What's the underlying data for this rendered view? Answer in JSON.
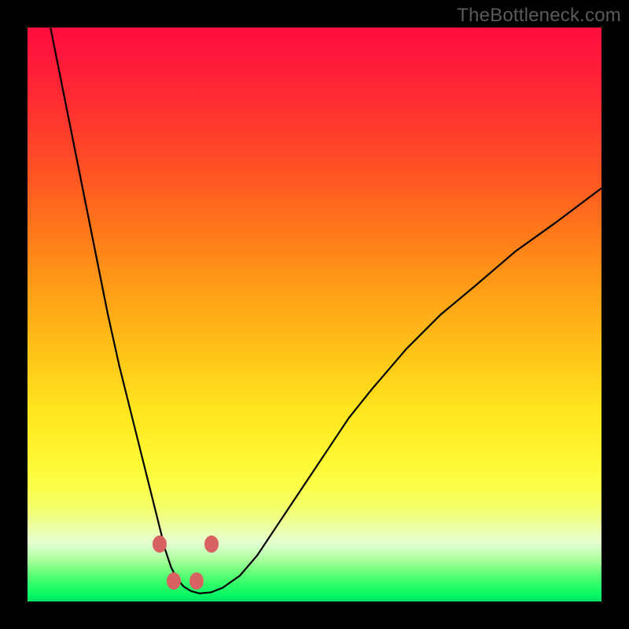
{
  "watermark": "TheBottleneck.com",
  "colors": {
    "page_bg": "#000000",
    "curve": "#000000",
    "marker": "#d86262",
    "watermark": "#5a5a5a"
  },
  "chart_data": {
    "type": "line",
    "title": "",
    "xlabel": "",
    "ylabel": "",
    "xlim": [
      0,
      100
    ],
    "ylim": [
      0,
      100
    ],
    "grid": false,
    "legend": false,
    "series": [
      {
        "name": "bottleneck-curve",
        "x": [
          4,
          6,
          8,
          10,
          12,
          14,
          16,
          18,
          20,
          21.5,
          23,
          24,
          25,
          26,
          27.2,
          28.5,
          30,
          32,
          34,
          37,
          40,
          44,
          48,
          52,
          56,
          60,
          66,
          72,
          78,
          85,
          92,
          100
        ],
        "y": [
          100,
          90,
          80,
          70,
          60,
          50,
          41,
          33,
          25,
          19,
          13,
          9,
          6,
          4,
          2.6,
          1.8,
          1.4,
          1.6,
          2.4,
          4.5,
          8,
          14,
          20,
          26,
          32,
          37,
          44,
          50,
          55,
          61,
          66,
          72
        ]
      }
    ],
    "markers": [
      {
        "name": "left-upper",
        "x": 23.0,
        "y": 10.0
      },
      {
        "name": "left-lower",
        "x": 25.5,
        "y": 3.5
      },
      {
        "name": "right-lower",
        "x": 29.5,
        "y": 3.5
      },
      {
        "name": "right-upper",
        "x": 32.0,
        "y": 10.0
      }
    ],
    "gradient": {
      "top": "#ff0d3e",
      "mid_upper": "#ff9a18",
      "mid": "#fff52e",
      "mid_lower": "#ecffa3",
      "bottom": "#03e060"
    }
  }
}
